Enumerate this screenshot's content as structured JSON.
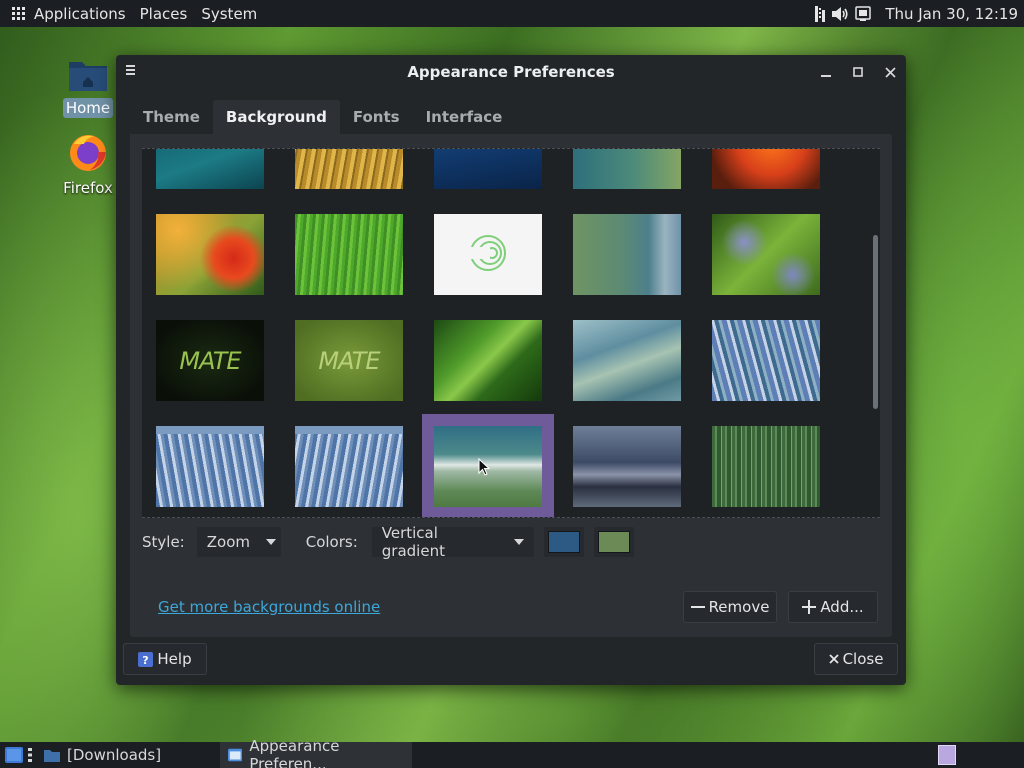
{
  "top_panel": {
    "menus": [
      "Applications",
      "Places",
      "System"
    ],
    "clock": "Thu Jan 30, 12:19"
  },
  "desktop": {
    "icons": [
      {
        "label": "Home",
        "icon": "folder-home-icon"
      },
      {
        "label": "Firefox",
        "icon": "firefox-icon"
      }
    ]
  },
  "window": {
    "title": "Appearance Preferences",
    "tabs": [
      "Theme",
      "Background",
      "Fonts",
      "Interface"
    ],
    "active_tab": "Background",
    "wallpapers": [
      {
        "name": "teal-partial",
        "selected": false
      },
      {
        "name": "wheat-partial",
        "selected": false
      },
      {
        "name": "blue-water-partial",
        "selected": false
      },
      {
        "name": "blue-green-partial",
        "selected": false
      },
      {
        "name": "orange-flower-partial",
        "selected": false
      },
      {
        "name": "red-flower",
        "selected": false
      },
      {
        "name": "green-grass",
        "selected": false
      },
      {
        "name": "white-spiral-logo",
        "selected": false
      },
      {
        "name": "green-blue-curves",
        "selected": false
      },
      {
        "name": "ladybug-flowers",
        "selected": false
      },
      {
        "name": "mate-dark",
        "text": "MATE",
        "selected": false
      },
      {
        "name": "mate-green",
        "text": "MATE",
        "selected": false
      },
      {
        "name": "green-leaf-drops",
        "selected": false
      },
      {
        "name": "blue-waves",
        "selected": false
      },
      {
        "name": "blue-abstract",
        "selected": false
      },
      {
        "name": "abstract-reflection-1",
        "selected": false
      },
      {
        "name": "abstract-reflection-2",
        "selected": false
      },
      {
        "name": "cloud-gradient",
        "selected": true
      },
      {
        "name": "stormy-sea",
        "selected": false
      },
      {
        "name": "green-stripes",
        "selected": false
      }
    ],
    "style_label": "Style:",
    "style_value": "Zoom",
    "colors_label": "Colors:",
    "colors_value": "Vertical gradient",
    "primary_color": "#2c5a85",
    "secondary_color": "#6b8a55",
    "more_link": "Get more backgrounds online",
    "remove_button": "Remove",
    "add_button": "Add...",
    "help_button": "Help",
    "close_button": "Close"
  },
  "taskbar": {
    "tasks": [
      {
        "label": "[Downloads]",
        "active": false
      },
      {
        "label": "Appearance Preferen...",
        "active": true
      }
    ]
  }
}
